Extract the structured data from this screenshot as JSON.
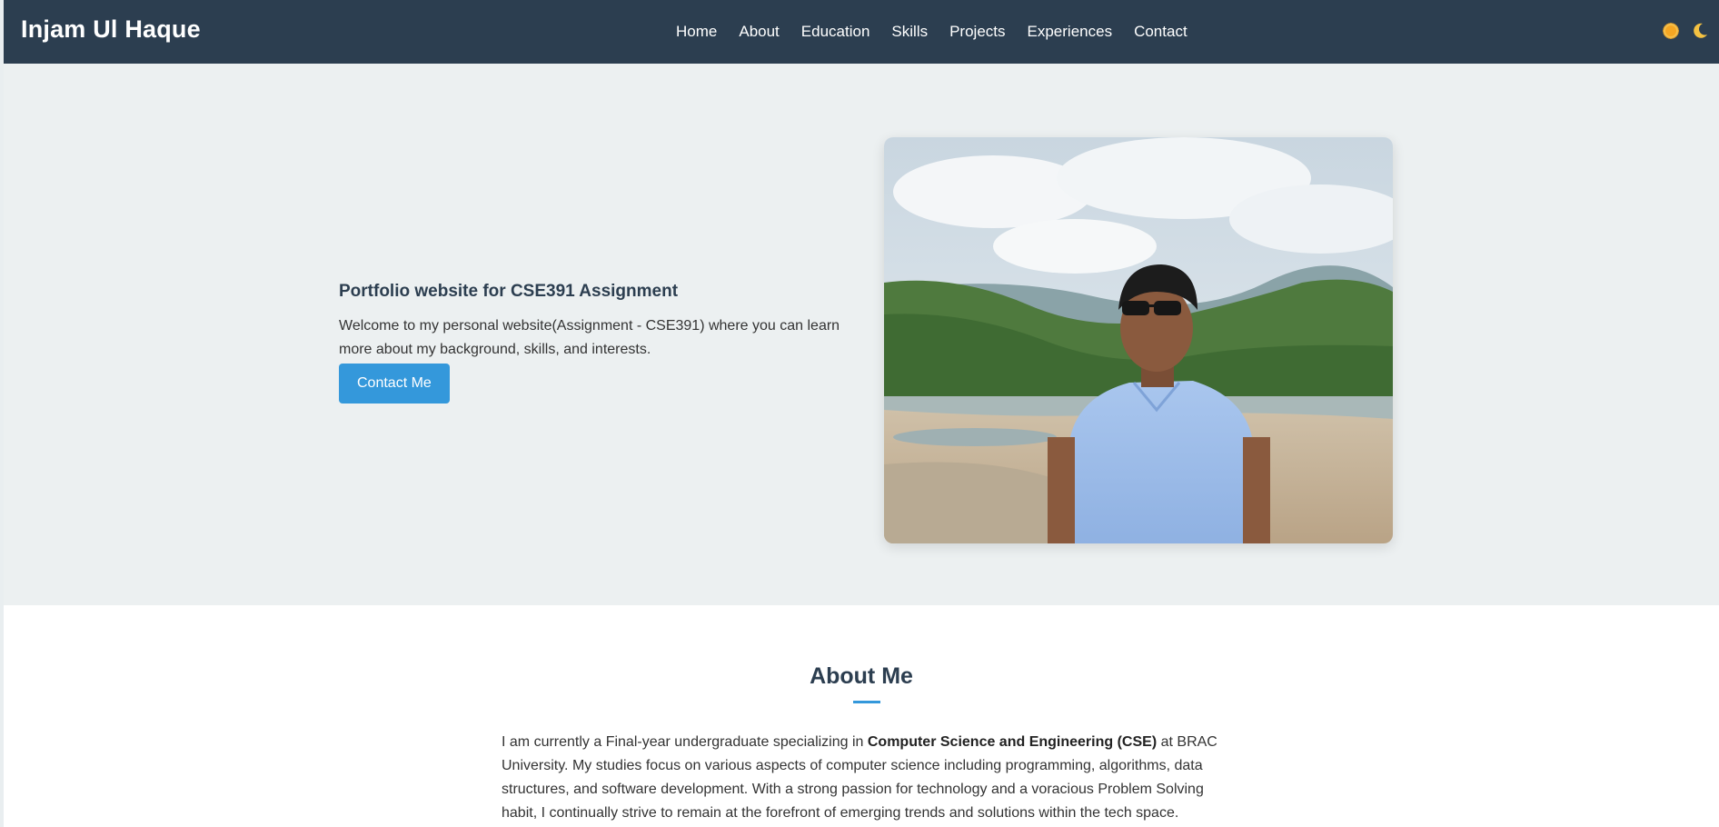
{
  "nav": {
    "brand": "Injam Ul Haque",
    "links": [
      "Home",
      "About",
      "Education",
      "Skills",
      "Projects",
      "Experiences",
      "Contact"
    ],
    "icons": [
      "sun-icon",
      "moon-icon"
    ]
  },
  "hero": {
    "title": "Portfolio website for CSE391 Assignment",
    "description": "Welcome to my personal website(Assignment - CSE391) where you can learn more about my background, skills, and interests.",
    "button_label": "Contact Me"
  },
  "about": {
    "title": "About Me",
    "text_before": "I am currently a Final-year undergraduate specializing in ",
    "text_bold": "Computer Science and Engineering (CSE)",
    "text_after": " at BRAC University. My studies focus on various aspects of computer science including programming, algorithms, data structures, and software development. With a strong passion for technology and a voracious Problem Solving habit, I continually strive to remain at the forefront of emerging trends and solutions within the tech space."
  },
  "colors": {
    "navbar": "#2c3e50",
    "accent": "#3498db",
    "hero_bg": "#ecf0f1"
  }
}
